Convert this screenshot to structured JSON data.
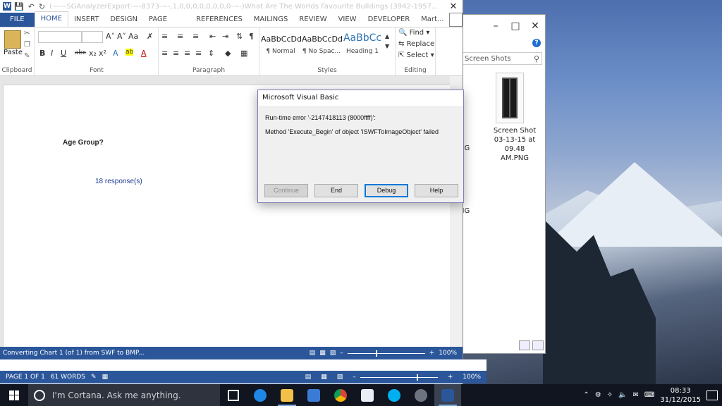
{
  "word": {
    "title": "(~-~SGAnalyzerExport-~-8373-~-,1,0,0,0,0,0,0,0,0-~-)What Are The Worlds Favourite Buildings (3942-1957...",
    "app_icon": "W",
    "tabs": [
      "FILE",
      "HOME",
      "INSERT",
      "DESIGN",
      "PAGE LAYOUT",
      "REFERENCES",
      "MAILINGS",
      "REVIEW",
      "VIEW",
      "DEVELOPER",
      "Mart..."
    ],
    "active_tab": "HOME",
    "ribbon": {
      "clipboard": {
        "paste": "Paste",
        "label": "Clipboard"
      },
      "font": {
        "label": "Font"
      },
      "paragraph": {
        "label": "Paragraph"
      },
      "styles": {
        "label": "Styles",
        "items": [
          {
            "sample": "AaBbCcDd",
            "name": "¶ Normal"
          },
          {
            "sample": "AaBbCcDd",
            "name": "¶ No Spac..."
          },
          {
            "sample": "AaBbCc",
            "name": "Heading 1"
          }
        ]
      },
      "editing": {
        "label": "Editing",
        "find": "Find",
        "replace": "Replace",
        "select": "Select"
      }
    },
    "document": {
      "question": "Age Group?",
      "responses": "18 response(s)"
    },
    "status_converting": "Converting Chart 1 (of 1) from SWF to BMP...",
    "status_page": "PAGE 1 OF 1",
    "status_words": "61 WORDS",
    "zoom": "100%"
  },
  "dialog": {
    "title": "Microsoft Visual Basic",
    "error_line": "Run-time error '-2147418113 (8000ffff)':",
    "message": "Method 'Execute_Begin' of object 'ISWFToImageObject' failed",
    "buttons": {
      "continue": "Continue",
      "end": "End",
      "debug": "Debug",
      "help": "Help"
    }
  },
  "explorer": {
    "search_placeholder": "Screen Shots",
    "file_caption": "Screen Shot 03-13-15 at 09.48 AM.PNG",
    "partial_labels": [
      "t",
      "NG",
      "t",
      "NG"
    ]
  },
  "taskbar": {
    "cortana": "I'm Cortana. Ask me anything.",
    "time": "08:33",
    "date": "31/12/2015"
  },
  "colors": {
    "word_blue": "#2b579a",
    "taskbar": "#10151f"
  }
}
